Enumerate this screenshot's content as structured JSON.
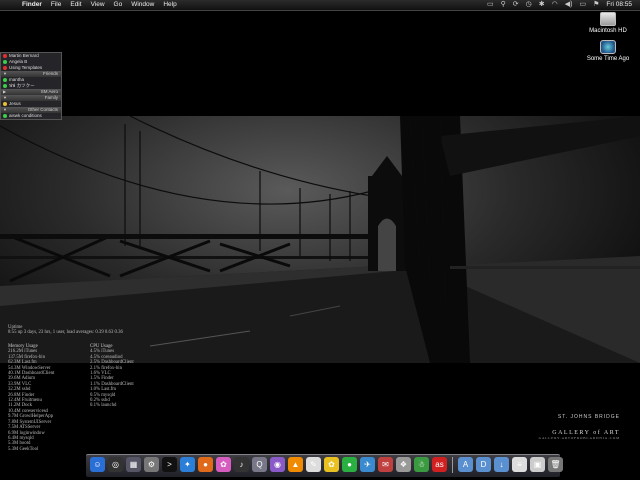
{
  "menubar": {
    "apple_glyph": "",
    "items": [
      "Finder",
      "File",
      "Edit",
      "View",
      "Go",
      "Window",
      "Help"
    ],
    "clock": "Fri 08:55",
    "status_icons": [
      "screen-icon",
      "spotlight-icon",
      "sync-icon",
      "time-machine-icon",
      "bluetooth-icon",
      "wifi-icon",
      "volume-icon",
      "battery-icon",
      "flag-icon"
    ]
  },
  "desktop": {
    "icons": [
      {
        "label": "Macintosh HD",
        "icon": "hard-drive-icon"
      },
      {
        "label": "Some Time Ago",
        "icon": "time-machine-disk-icon"
      }
    ]
  },
  "buddylist": {
    "rows": [
      {
        "type": "buddy",
        "name": "Martin Bernard",
        "status": "#e03030"
      },
      {
        "type": "buddy",
        "name": "Angela B",
        "status": "#3ad04a"
      },
      {
        "type": "buddy",
        "name": "Using Templates",
        "status": "#e03030"
      },
      {
        "type": "group",
        "name": "Friends"
      },
      {
        "type": "buddy",
        "name": "mantha",
        "status": "#3ad04a"
      },
      {
        "type": "buddy",
        "name": "ฟฟ カツクー",
        "status": "#3ad04a"
      },
      {
        "type": "group",
        "name": "SM Aero"
      },
      {
        "type": "group",
        "name": "Family"
      },
      {
        "type": "buddy",
        "name": "Jesus",
        "status": "#e8c030"
      },
      {
        "type": "group",
        "name": "Other Contacts"
      },
      {
        "type": "buddy",
        "name": "aiswk conditions",
        "status": "#3ad04a"
      }
    ]
  },
  "stats": {
    "uptime_label": "Uptime",
    "uptime_value": "8:55  up 3 days, 23 hrs, 1 user, load averages: 0.39 0.63 0.36",
    "memory_header": "Memory Usage",
    "memory": [
      "216.2M iTunes",
      "137.5M firefox-bin",
      "62.3M Last.fm",
      "54.3M WindowServer",
      "40.1M DashboardClient",
      "39.6M Adium",
      "33.9M VLC",
      "32.2M sshd",
      "26.8M Finder",
      "12.4M Fruitmenu",
      "11.2M Dock",
      "10.4M coreservicesd",
      "9.7M GrowlHelperApp",
      "7.8M SystemUIServer",
      "7.5M ATSServer",
      "6.9M loginwindow",
      "6.4M mysqld",
      "5.3M bootd",
      "5.3M GeekTool"
    ],
    "cpu_header": "CPU Usage",
    "cpu": [
      "4.5% iTunes",
      "4.5% coreaudiod",
      "2.5% DashboardClient",
      "2.1% firefox-bin",
      "1.6% VLC",
      "1.5% Finder",
      "1.1% DashboardClient",
      "1.0% Last.fm",
      "0.5% mysqld",
      "0.2% sshd",
      "0.1% launchd"
    ]
  },
  "wallpaper": {
    "caption": "ST. JOHNS BRIDGE",
    "brand": "GALLERY of ART",
    "brand_sub": "GALLERY.ARTOFROBCARDNIA.COM"
  },
  "dock": {
    "items": [
      {
        "name": "finder-icon",
        "color": "#2a6fd6",
        "glyph": "☺"
      },
      {
        "name": "dashboard-icon",
        "color": "#333",
        "glyph": "◎"
      },
      {
        "name": "expose-icon",
        "color": "#556",
        "glyph": "▦"
      },
      {
        "name": "system-preferences-icon",
        "color": "#777",
        "glyph": "⚙"
      },
      {
        "name": "terminal-icon",
        "color": "#111",
        "glyph": ">"
      },
      {
        "name": "safari-icon",
        "color": "#2b7fd8",
        "glyph": "✦"
      },
      {
        "name": "firefox-icon",
        "color": "#e06a1a",
        "glyph": "●"
      },
      {
        "name": "photo-icon",
        "color": "#d65cc0",
        "glyph": "✿"
      },
      {
        "name": "itunes-icon",
        "color": "#333",
        "glyph": "♪"
      },
      {
        "name": "quicktime-icon",
        "color": "#778",
        "glyph": "Q"
      },
      {
        "name": "dvd-icon",
        "color": "#8a5bc8",
        "glyph": "◉"
      },
      {
        "name": "vlc-icon",
        "color": "#f08a00",
        "glyph": "▲"
      },
      {
        "name": "script-icon",
        "color": "#ddd",
        "glyph": "✎"
      },
      {
        "name": "messenger-icon",
        "color": "#e8c020",
        "glyph": "✿"
      },
      {
        "name": "adium-icon",
        "color": "#2ab040",
        "glyph": "●"
      },
      {
        "name": "utility-icon",
        "color": "#3a8ad0",
        "glyph": "✈"
      },
      {
        "name": "mail-icon",
        "color": "#c04040",
        "glyph": "✉"
      },
      {
        "name": "lyrics-icon",
        "color": "#999",
        "glyph": "❖"
      },
      {
        "name": "contacts-icon",
        "color": "#3a9a40",
        "glyph": "☃"
      },
      {
        "name": "lastfm-icon",
        "color": "#d02020",
        "glyph": "as"
      },
      {
        "name": "applications-folder-icon",
        "color": "#5a8fd0",
        "glyph": "A"
      },
      {
        "name": "documents-folder-icon",
        "color": "#5a8fd0",
        "glyph": "D"
      },
      {
        "name": "downloads-folder-icon",
        "color": "#5a8fd0",
        "glyph": "↓"
      },
      {
        "name": "document-stack-icon",
        "color": "#ddd",
        "glyph": "≡"
      },
      {
        "name": "image-stack-icon",
        "color": "#ccc",
        "glyph": "▣"
      },
      {
        "name": "trash-icon",
        "color": "#777",
        "glyph": "🗑"
      }
    ]
  }
}
